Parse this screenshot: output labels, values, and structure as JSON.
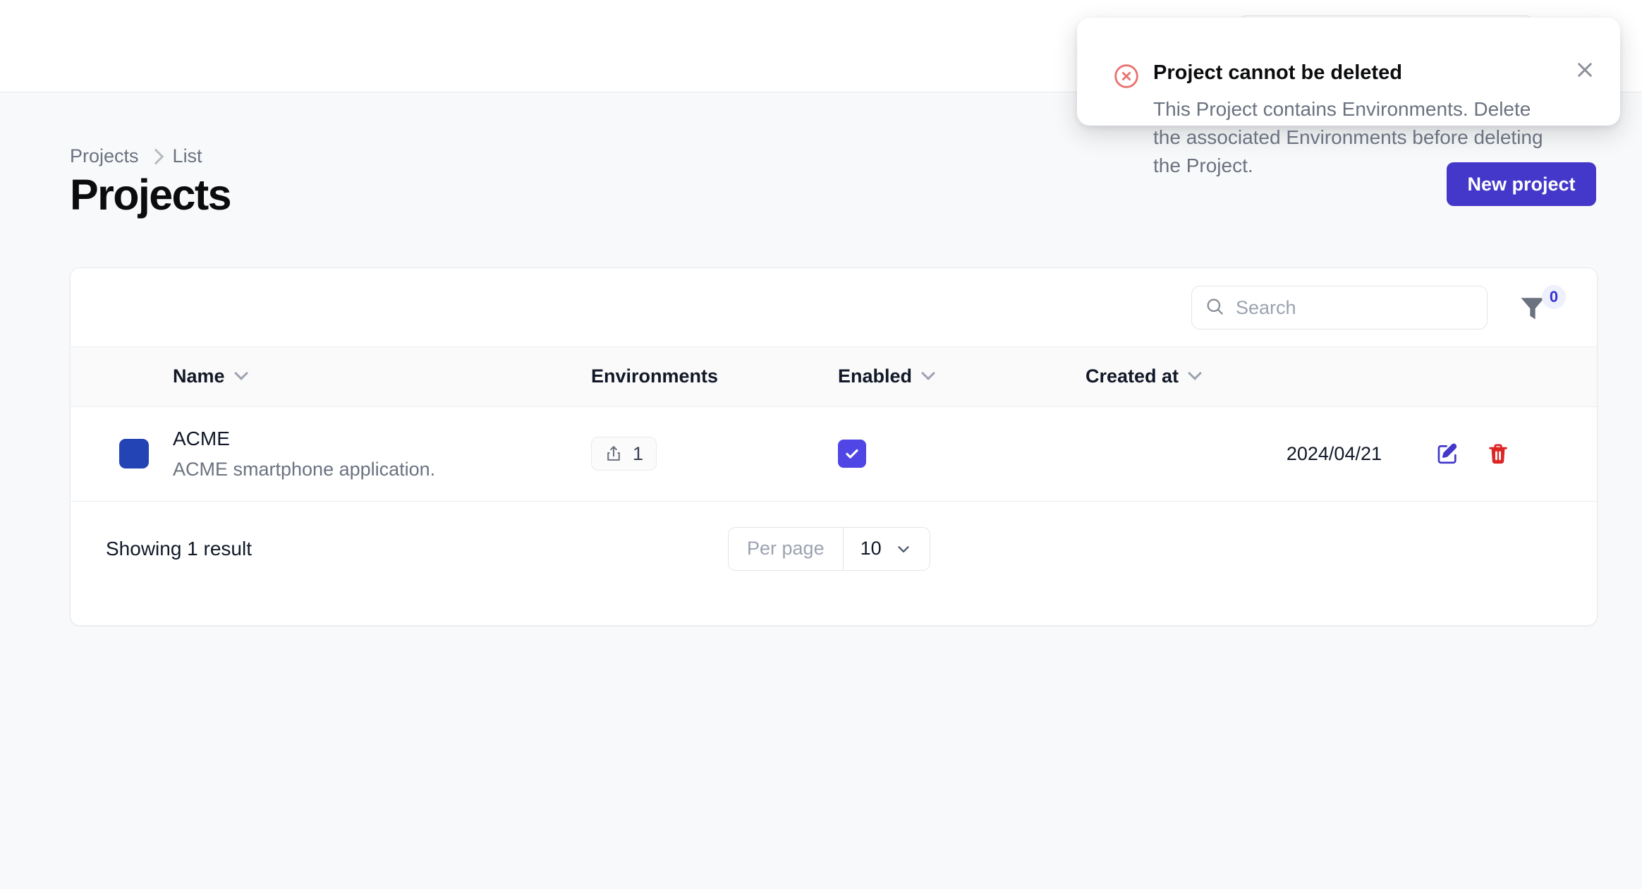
{
  "app": {
    "background_color": "#f8f9fa",
    "accent_color": "#4f46e5",
    "brand_button_color": "#4338ca",
    "avatar_color": "#2244b4",
    "danger_color": "#dc2626",
    "toast_icon_color": "#e8736f"
  },
  "topbar": {
    "search_placeholder": ""
  },
  "breadcrumb": {
    "items": [
      {
        "label": "Projects"
      },
      {
        "label": "List"
      }
    ],
    "separator_icon": "chevron-right-icon"
  },
  "header": {
    "title": "Projects",
    "new_project_label": "New project"
  },
  "toolbar": {
    "search_placeholder": "Search",
    "search_value": "",
    "search_icon": "search-icon",
    "filter_icon": "filter-funnel-icon",
    "filter_count": "0"
  },
  "table": {
    "columns": [
      {
        "key": "avatar",
        "label": "",
        "sortable": false
      },
      {
        "key": "name",
        "label": "Name",
        "sortable": true
      },
      {
        "key": "envs",
        "label": "Environments",
        "sortable": false
      },
      {
        "key": "enabled",
        "label": "Enabled",
        "sortable": true
      },
      {
        "key": "created",
        "label": "Created at",
        "sortable": true
      },
      {
        "key": "actions",
        "label": "",
        "sortable": false
      }
    ],
    "rows": [
      {
        "name": "ACME",
        "description": "ACME smartphone application.",
        "environments_count": "1",
        "environments_icon": "share-export-icon",
        "enabled": true,
        "created_at": "2024/04/21",
        "edit_icon": "edit-pencil-square-icon",
        "delete_icon": "trash-icon"
      }
    ]
  },
  "footer": {
    "showing_text": "Showing 1 result",
    "per_page_label": "Per page",
    "per_page_value": "10",
    "per_page_options": [
      "10"
    ],
    "chevron_icon": "chevron-down-icon"
  },
  "toast": {
    "icon": "error-circle-x-icon",
    "title": "Project cannot be deleted",
    "message": "This Project contains Environments. Delete the associated Environments before deleting the Project.",
    "close_icon": "close-x-icon"
  }
}
